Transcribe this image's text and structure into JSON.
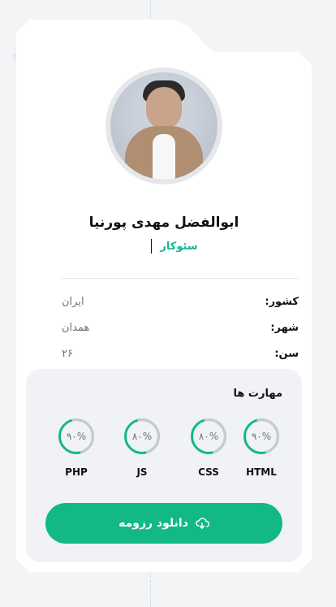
{
  "profile": {
    "name": "ابوالفضل مهدی پورنیا",
    "role": "سئوکار"
  },
  "details": {
    "country_label": "کشور:",
    "country_value": "ایران",
    "city_label": "شهر:",
    "city_value": "همدان",
    "age_label": "سن:",
    "age_value": "۲۶"
  },
  "skills": {
    "title": "مهارت ها",
    "items": [
      {
        "name": "HTML",
        "percent": "۹۰%"
      },
      {
        "name": "CSS",
        "percent": "۸۰%"
      },
      {
        "name": "JS",
        "percent": "۸۰%"
      },
      {
        "name": "PHP",
        "percent": "۹۰%"
      }
    ]
  },
  "actions": {
    "download_resume": "دانلود رزومه"
  },
  "icons": {
    "download": "cloud-download-icon"
  },
  "colors": {
    "accent": "#12b886",
    "role": "#16b58e",
    "panel": "#f1f2f6"
  }
}
